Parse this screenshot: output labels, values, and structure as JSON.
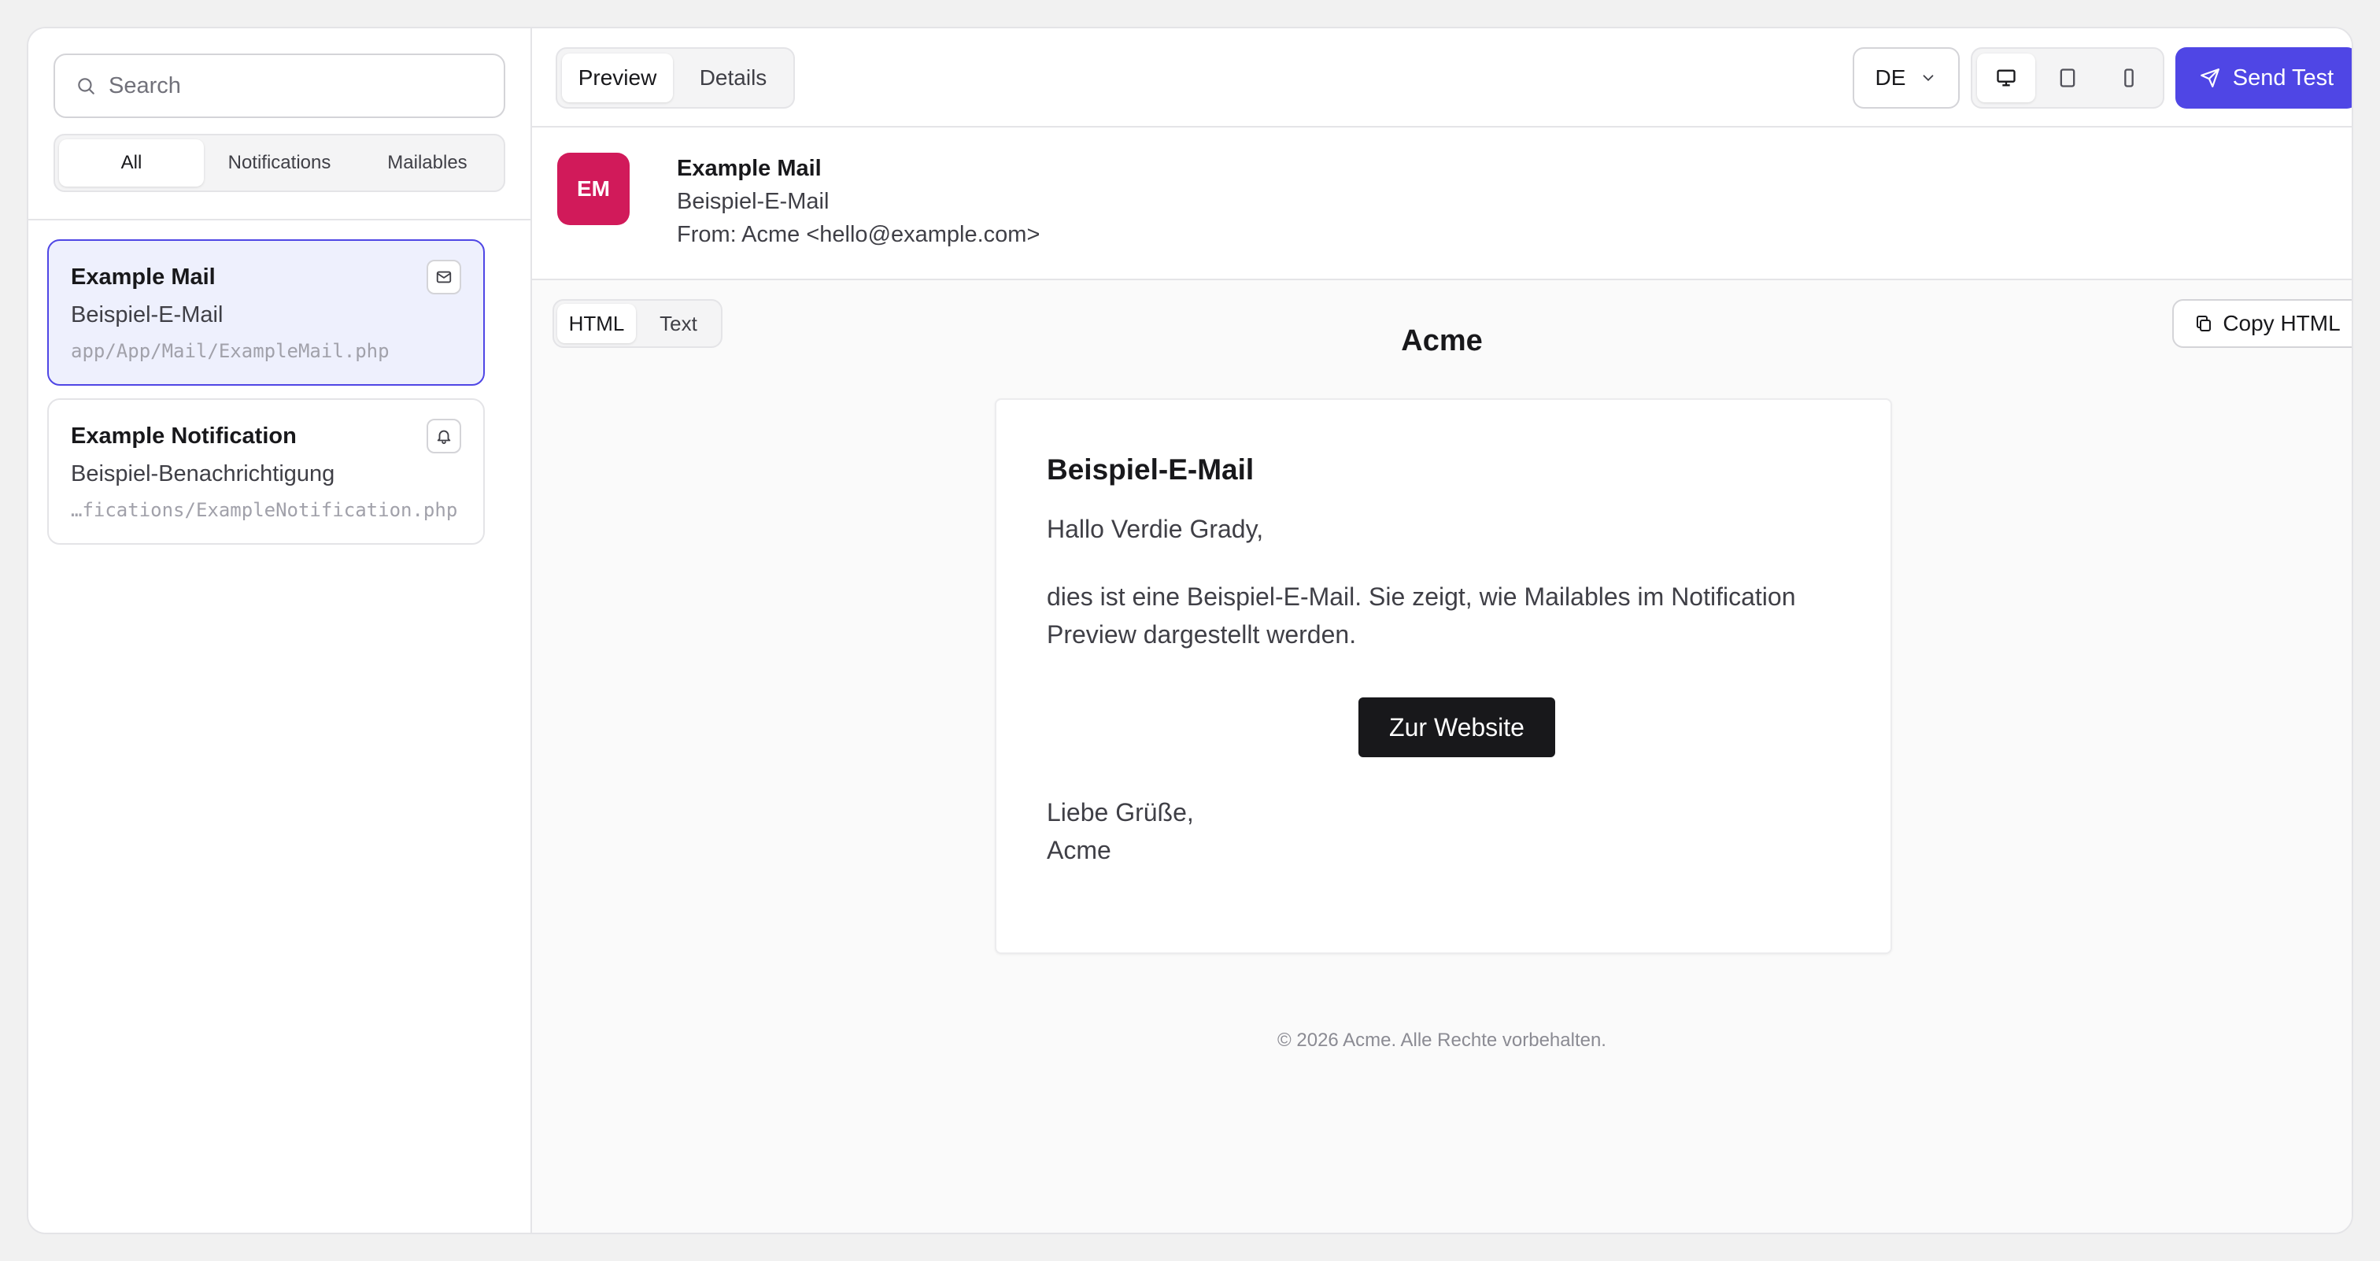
{
  "sidebar": {
    "search": {
      "placeholder": "Search",
      "value": ""
    },
    "filters": [
      {
        "label": "All",
        "active": true
      },
      {
        "label": "Notifications",
        "active": false
      },
      {
        "label": "Mailables",
        "active": false
      }
    ],
    "items": [
      {
        "title": "Example Mail",
        "subtitle": "Beispiel-E-Mail",
        "path": "app/App/Mail/ExampleMail.php",
        "icon": "mail-icon",
        "selected": true
      },
      {
        "title": "Example Notification",
        "subtitle": "Beispiel-Benachrichtigung",
        "path": "…fications/ExampleNotification.php",
        "icon": "bell-icon",
        "selected": false
      }
    ]
  },
  "toolbar": {
    "view_tabs": [
      {
        "label": "Preview",
        "active": true
      },
      {
        "label": "Details",
        "active": false
      }
    ],
    "locale": "DE",
    "devices": [
      {
        "icon": "desktop-icon",
        "active": true
      },
      {
        "icon": "tablet-icon",
        "active": false
      },
      {
        "icon": "mobile-icon",
        "active": false
      }
    ],
    "send_label": "Send Test",
    "accent_color": "#4f46e5"
  },
  "mail_header": {
    "avatar_initials": "EM",
    "avatar_color": "#d11a5a",
    "title": "Example Mail",
    "subtitle": "Beispiel-E-Mail",
    "from": "From: Acme <hello@example.com>"
  },
  "preview": {
    "format_tabs": [
      {
        "label": "HTML",
        "active": true
      },
      {
        "label": "Text",
        "active": false
      }
    ],
    "copy_label": "Copy HTML",
    "brand": "Acme",
    "email": {
      "heading": "Beispiel-E-Mail",
      "greeting": "Hallo Verdie Grady,",
      "body": "dies ist eine Beispiel-E-Mail. Sie zeigt, wie Mailables im Notification Preview dargestellt werden.",
      "button": "Zur Website",
      "signoff_line1": "Liebe Grüße,",
      "signoff_line2": "Acme"
    },
    "footer": "© 2026 Acme. Alle Rechte vorbehalten."
  }
}
